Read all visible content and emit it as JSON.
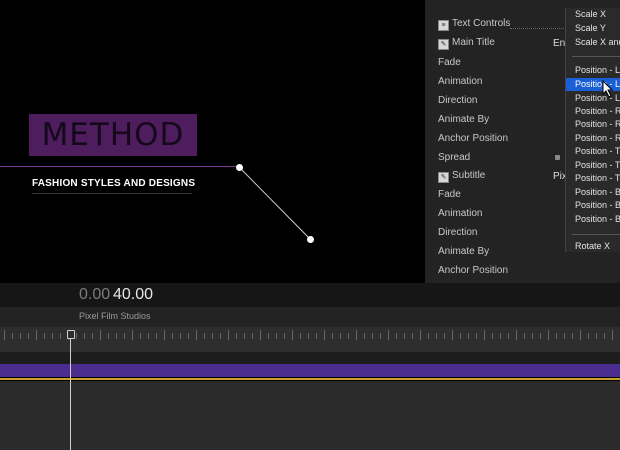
{
  "viewer": {
    "title": "METHOD",
    "subtitle": "FASHION STYLES AND DESIGNS"
  },
  "inspector": {
    "rows": [
      {
        "label": "Text Controls",
        "icon": "text-controls-icon"
      },
      {
        "label": "Main Title",
        "icon": "main-title-icon"
      },
      {
        "label": "Fade"
      },
      {
        "label": "Animation"
      },
      {
        "label": "Direction"
      },
      {
        "label": "Animate By"
      },
      {
        "label": "Anchor Position"
      },
      {
        "label": "Spread"
      },
      {
        "label": "Subtitle",
        "icon": "subtitle-icon"
      },
      {
        "label": "Fade"
      },
      {
        "label": "Animation"
      },
      {
        "label": "Direction"
      },
      {
        "label": "Animate By"
      },
      {
        "label": "Anchor Position"
      }
    ],
    "main_title_value": "En",
    "subtitle_value": "Pix"
  },
  "menu": {
    "items": [
      "Scale X",
      "Scale Y",
      "Scale X and",
      "Position - L",
      "Position - L",
      "Position - L",
      "Position - R",
      "Position - R",
      "Position - R",
      "Position - T",
      "Position - T",
      "Position - T",
      "Position - B",
      "Position - B",
      "Position - B",
      "Rotate X"
    ],
    "selected_index": 4
  },
  "timeline": {
    "timecode_dim": "0.00",
    "timecode_bright": "40.00",
    "project_name": "Pixel Film Studios"
  },
  "colors": {
    "title_box": "#4e1d5e",
    "clip": "#4a2d8f",
    "selection": "#1b5fd6",
    "clip_marker": "#c9a030"
  }
}
